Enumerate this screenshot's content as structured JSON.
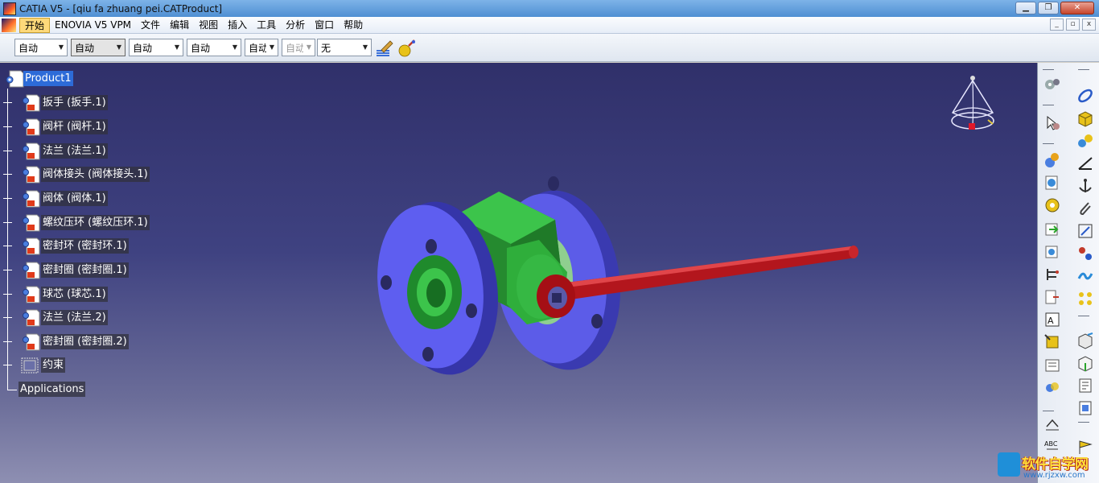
{
  "window": {
    "title": "CATIA V5 - [qiu fa zhuang pei.CATProduct]",
    "buttons": {
      "minimize": "▁",
      "maximize": "❐",
      "close": "✕"
    },
    "mdi_buttons": {
      "minimize": "_",
      "restore": "▫",
      "close": "x"
    }
  },
  "menu": {
    "items": [
      {
        "label": "开始",
        "active": true
      },
      {
        "label": "ENOVIA V5 VPM"
      },
      {
        "label": "文件"
      },
      {
        "label": "编辑"
      },
      {
        "label": "视图"
      },
      {
        "label": "插入"
      },
      {
        "label": "工具"
      },
      {
        "label": "分析"
      },
      {
        "label": "窗口"
      },
      {
        "label": "帮助"
      }
    ]
  },
  "toolbar": {
    "combos": [
      "自动",
      "自动",
      "自动",
      "自动",
      "自动",
      "自动",
      "无"
    ],
    "icons": [
      "painter-brush-icon",
      "apply-material-icon"
    ]
  },
  "tree": {
    "root": "Product1",
    "children": [
      "扳手 (扳手.1)",
      "阀杆 (阀杆.1)",
      "法兰 (法兰.1)",
      "阀体接头 (阀体接头.1)",
      "阀体 (阀体.1)",
      "螺纹压环 (螺纹压环.1)",
      "密封环 (密封环.1)",
      "密封圈 (密封圈.1)",
      "球芯 (球芯.1)",
      "法兰 (法兰.2)",
      "密封圈 (密封圈.2)"
    ],
    "constraints": "约束",
    "applications": "Applications"
  },
  "colors": {
    "flange": "#5b5be0",
    "body": "#2e9e3a",
    "handle": "#b3161d",
    "background_top": "#30306a",
    "background_bottom": "#8e8fb2"
  },
  "watermark": {
    "text": "软件自学网",
    "url": "www.rjzxw.com"
  }
}
